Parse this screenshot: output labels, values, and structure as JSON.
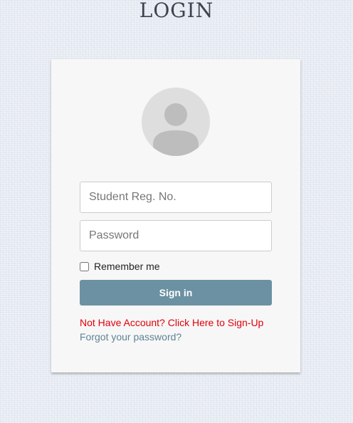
{
  "page": {
    "title": "LOGIN"
  },
  "form": {
    "avatar_icon": "user-avatar-icon",
    "reg_no_placeholder": "Student Reg. No.",
    "reg_no_value": "",
    "password_placeholder": "Password",
    "password_value": "",
    "remember_label": "Remember me",
    "remember_checked": false,
    "signin_label": "Sign in",
    "signup_link": "Not Have Account? Click Here to Sign-Up",
    "forgot_link": "Forgot your password?"
  },
  "colors": {
    "background": "#e6ebf3",
    "card": "#f7f7f7",
    "button": "#6b91a2",
    "signup_link": "#e0000b",
    "forgot_link": "#5e8494",
    "avatar": "#bdbdbd"
  }
}
